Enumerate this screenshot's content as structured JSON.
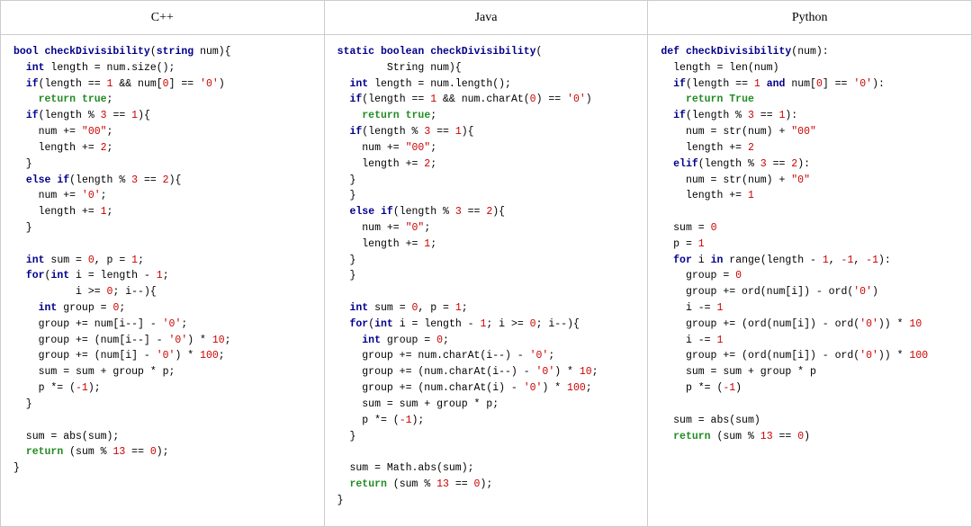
{
  "header": {
    "cpp_label": "C++",
    "java_label": "Java",
    "python_label": "Python"
  }
}
